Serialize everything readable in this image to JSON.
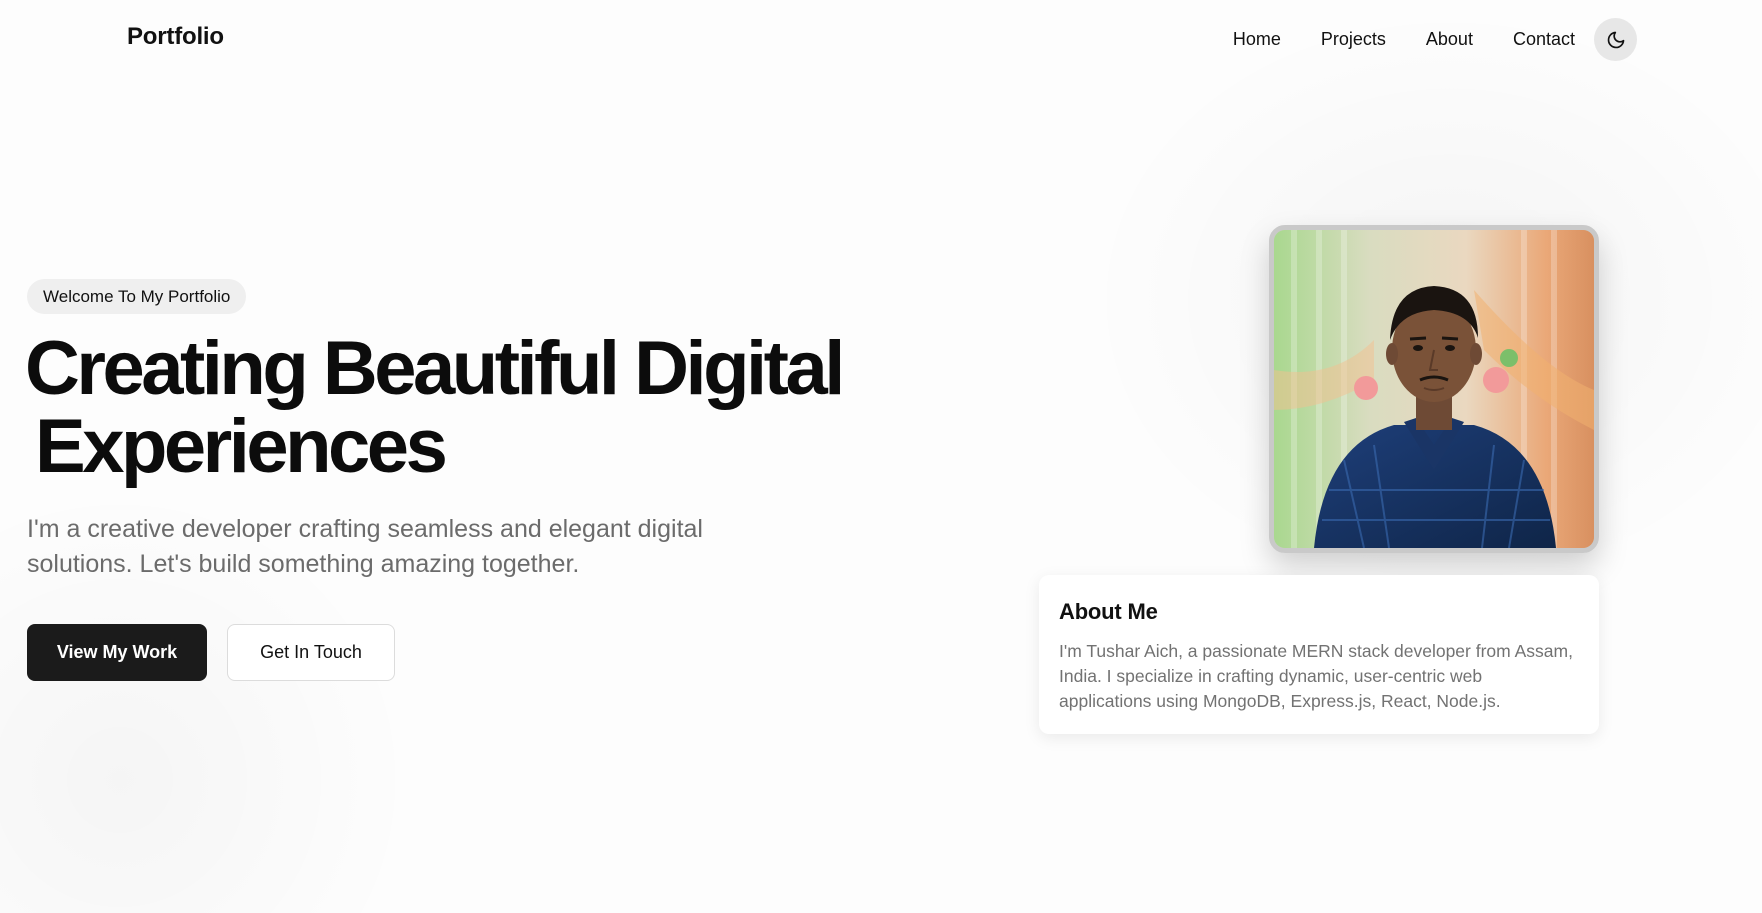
{
  "nav": {
    "brand": "Portfolio",
    "links": [
      "Home",
      "Projects",
      "About",
      "Contact"
    ],
    "theme_toggle_icon": "moon-icon"
  },
  "hero": {
    "badge": "Welcome To My Portfolio",
    "headline_line1": "Creating Beautiful Digital",
    "headline_line2": "Experiences",
    "subtitle": "I'm a creative developer crafting seamless and elegant digital solutions. Let's build something amazing together.",
    "primary_button": "View My Work",
    "secondary_button": "Get In Touch"
  },
  "about": {
    "title": "About Me",
    "text": "I'm Tushar Aich, a passionate MERN stack developer from Assam, India. I specialize in crafting dynamic, user-centric web applications using MongoDB, Express.js, React, Node.js."
  },
  "colors": {
    "primary_button_bg": "#1b1b1b",
    "subtitle_text": "#6b6b6b",
    "badge_bg": "#efefef"
  }
}
